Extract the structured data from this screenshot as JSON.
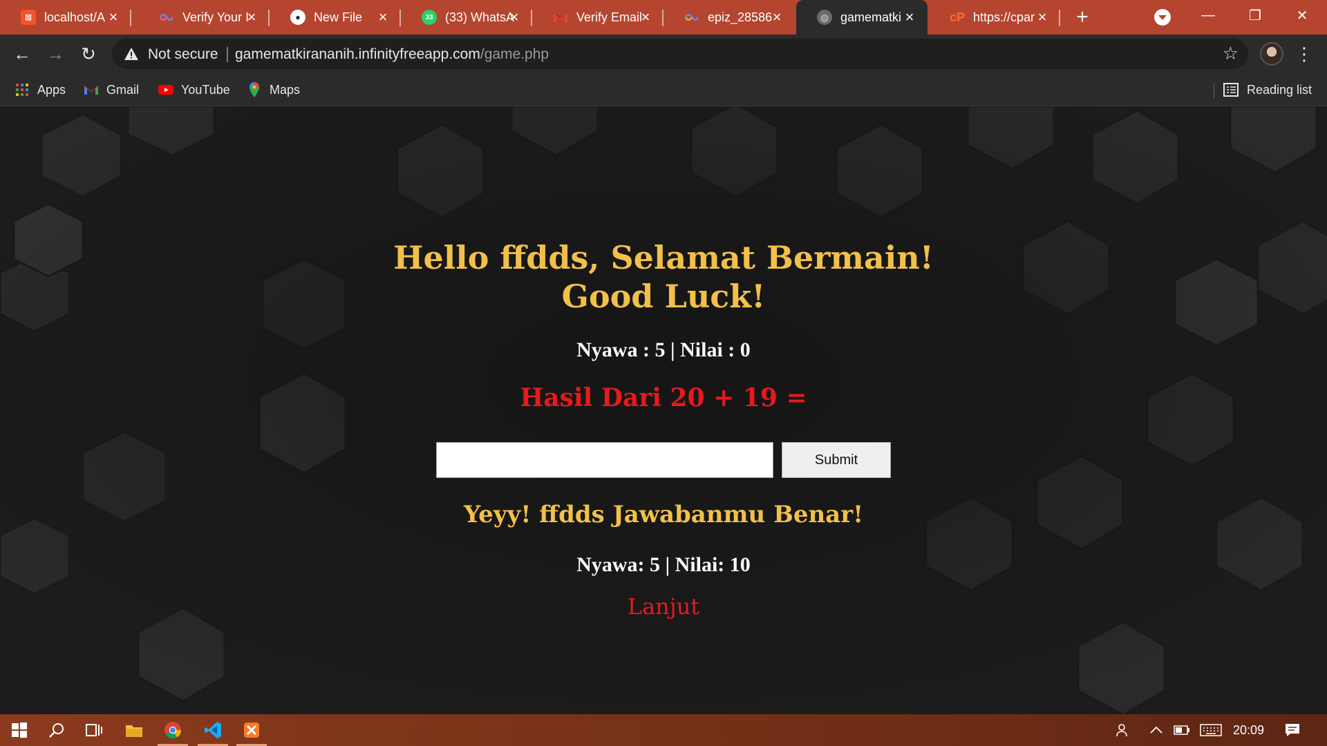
{
  "browser": {
    "tabs": [
      {
        "title": "localhost/A",
        "active": false
      },
      {
        "title": "Verify Your I",
        "active": false
      },
      {
        "title": "New File",
        "active": false
      },
      {
        "title": "(33) WhatsA",
        "active": false
      },
      {
        "title": "Verify Email",
        "active": false
      },
      {
        "title": "epiz_28586",
        "active": false
      },
      {
        "title": "gamematki",
        "active": true
      },
      {
        "title": "https://cpar",
        "active": false
      }
    ],
    "security_label": "Not secure",
    "url_host": "gamematkirananih.infinityfreeapp.com",
    "url_path": "/game.php",
    "bookmarks": [
      {
        "label": "Apps",
        "icon": "apps-grid-icon"
      },
      {
        "label": "Gmail",
        "icon": "gmail-icon"
      },
      {
        "label": "YouTube",
        "icon": "youtube-icon"
      },
      {
        "label": "Maps",
        "icon": "maps-icon"
      }
    ],
    "reading_list_label": "Reading list"
  },
  "page": {
    "heading_line1": "Hello ffdds, Selamat Bermain!",
    "heading_line2": "Good Luck!",
    "stats_before": "Nyawa : 5 | Nilai : 0",
    "question": "Hasil Dari 20 + 19 =",
    "answer_value": "",
    "submit_label": "Submit",
    "result_message": "Yeyy! ffdds Jawabanmu Benar!",
    "stats_after": "Nyawa: 5 | Nilai: 10",
    "next_label": "Lanjut",
    "colors": {
      "heading": "#f2c04a",
      "question": "#e8191d",
      "background": "#1c1c1c"
    }
  },
  "taskbar": {
    "clock": "20:09"
  }
}
